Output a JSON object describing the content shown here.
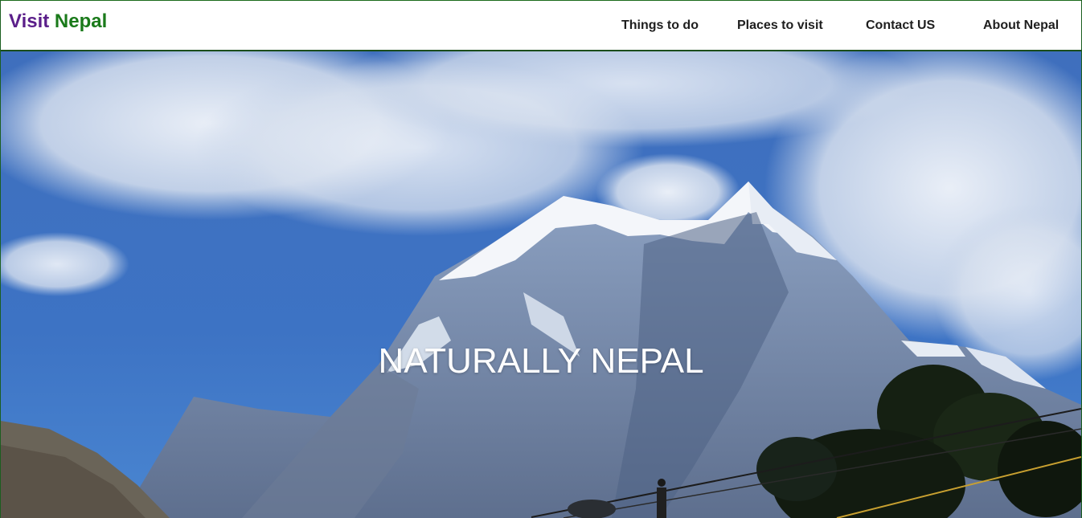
{
  "brand": {
    "word1": "Visit",
    "word2": "Nepal",
    "word1_color": "#5b1f8a",
    "word2_color": "#1a7a1a"
  },
  "nav": {
    "items": [
      {
        "label": "Things to do"
      },
      {
        "label": "Places to visit"
      },
      {
        "label": "Contact US"
      },
      {
        "label": "About Nepal"
      }
    ]
  },
  "hero": {
    "title": "NATURALLY NEPAL",
    "image_icon": "mountain-landscape-image"
  }
}
